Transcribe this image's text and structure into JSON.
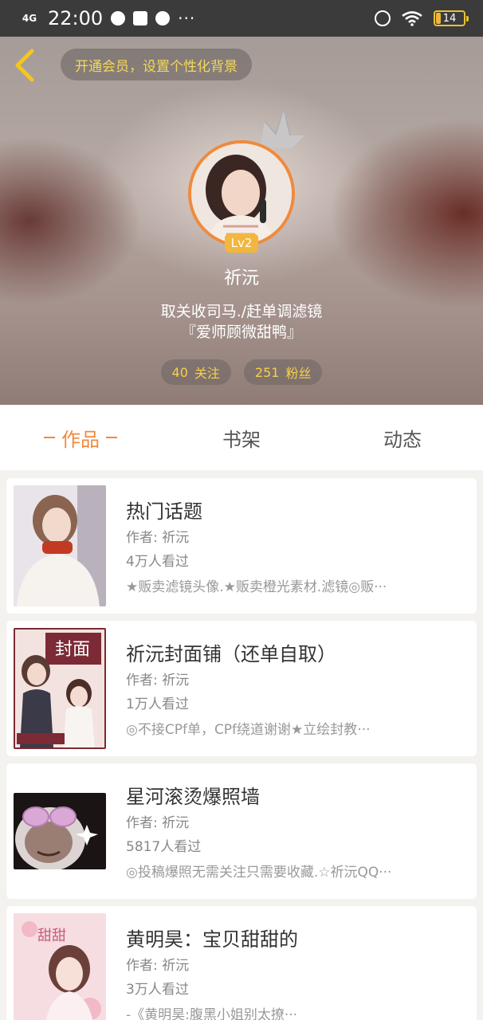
{
  "status_bar": {
    "network": "4G",
    "time": "22:00",
    "dots": "···",
    "battery": "14"
  },
  "header": {
    "vip_prompt": "开通会员，设置个性化背景",
    "level": "Lv2",
    "username": "祈沅",
    "bio_line1": "取关收司马./赶单调滤镜",
    "bio_line2": "『爱师顾微甜鸭』",
    "following_count": "40",
    "following_label": "关注",
    "followers_count": "251",
    "followers_label": "粉丝"
  },
  "tabs": [
    {
      "label": "作品",
      "active": true
    },
    {
      "label": "书架",
      "active": false
    },
    {
      "label": "动态",
      "active": false
    }
  ],
  "works": [
    {
      "title": "热门话题",
      "author": "作者: 祈沅",
      "views": "4万人看过",
      "desc": "★贩卖滤镜头像.★贩卖橙光素材.滤镜◎贩···"
    },
    {
      "title": "祈沅封面铺（还单自取）",
      "author": "作者: 祈沅",
      "views": "1万人看过",
      "desc": "◎不接CPf单，CPf绕道谢谢★立绘封教···"
    },
    {
      "title": "星河滚烫爆照墙",
      "author": "作者: 祈沅",
      "views": "5817人看过",
      "desc": "◎投稿爆照无需关注只需要收藏.☆祈沅QQ···"
    },
    {
      "title": "黄明昊：宝贝甜甜的",
      "author": "作者: 祈沅",
      "views": "3万人看过",
      "desc": "-《黄明昊:腹黑小姐别太撩···"
    }
  ],
  "colors": {
    "accent": "#f08a3c",
    "gold": "#f4d85a",
    "level_badge": "#f3b73e"
  }
}
